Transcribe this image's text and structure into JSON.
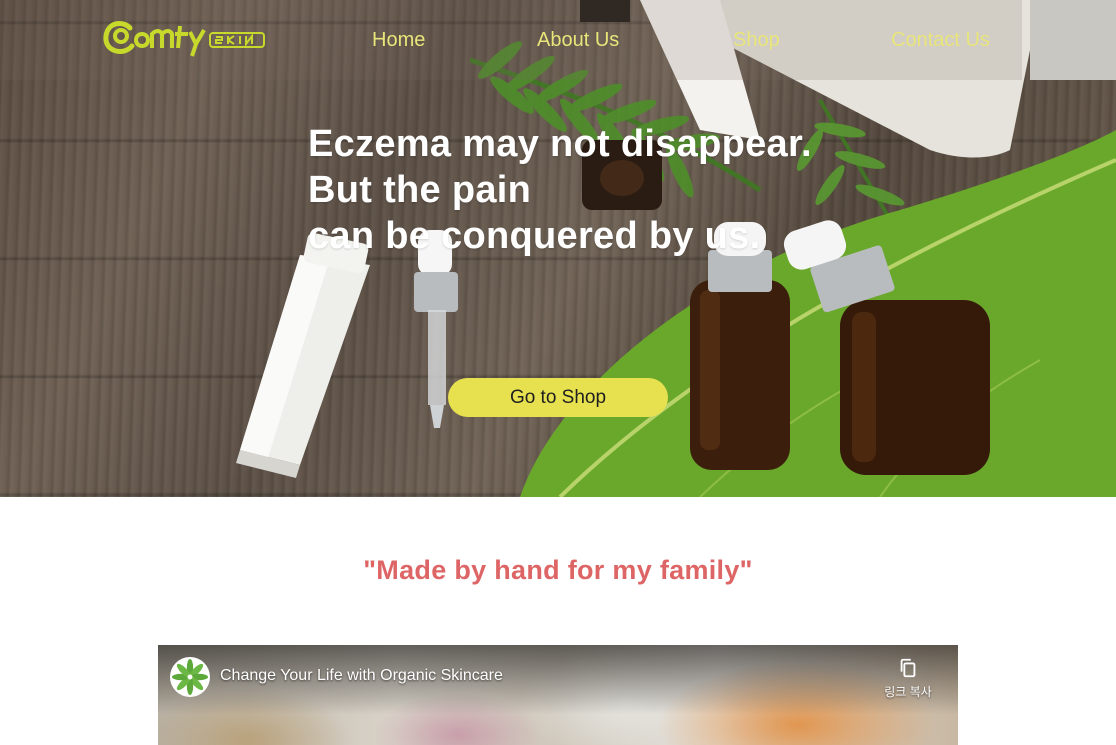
{
  "brand": {
    "logo_text": "omfy skin",
    "accent_color": "#e8e57a"
  },
  "nav": {
    "items": [
      {
        "label": "Home"
      },
      {
        "label": "About Us"
      },
      {
        "label": "Shop"
      },
      {
        "label": "Contact Us"
      }
    ]
  },
  "hero": {
    "headline_lines": [
      "Eczema may not disappear.",
      "But the pain",
      "can be conquered by us."
    ],
    "cta_label": "Go to Shop",
    "cta_color": "#e7e150"
  },
  "tagline": {
    "text": "\"Made by hand for my family\"",
    "color": "#de6565"
  },
  "video": {
    "title": "Change Your Life with Organic Skincare",
    "copy_link_label": "링크 복사",
    "channel_icon": "leaf-logo-icon",
    "copy_icon": "copy-icon"
  }
}
